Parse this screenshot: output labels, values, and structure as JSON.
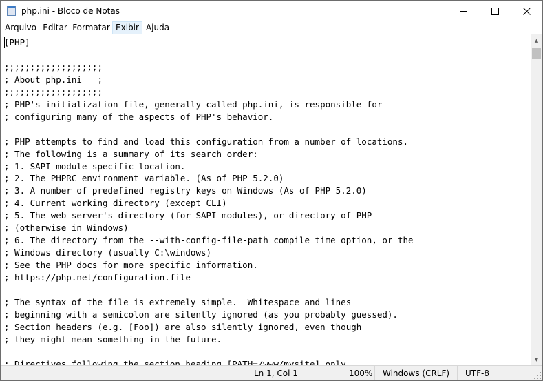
{
  "window": {
    "title": "php.ini - Bloco de Notas"
  },
  "menu": {
    "items": [
      "Arquivo",
      "Editar",
      "Formatar",
      "Exibir",
      "Ajuda"
    ],
    "active": "Exibir"
  },
  "editor": {
    "lines": [
      "[PHP]",
      "",
      ";;;;;;;;;;;;;;;;;;;",
      "; About php.ini   ;",
      ";;;;;;;;;;;;;;;;;;;",
      "; PHP's initialization file, generally called php.ini, is responsible for",
      "; configuring many of the aspects of PHP's behavior.",
      "",
      "; PHP attempts to find and load this configuration from a number of locations.",
      "; The following is a summary of its search order:",
      "; 1. SAPI module specific location.",
      "; 2. The PHPRC environment variable. (As of PHP 5.2.0)",
      "; 3. A number of predefined registry keys on Windows (As of PHP 5.2.0)",
      "; 4. Current working directory (except CLI)",
      "; 5. The web server's directory (for SAPI modules), or directory of PHP",
      "; (otherwise in Windows)",
      "; 6. The directory from the --with-config-file-path compile time option, or the",
      "; Windows directory (usually C:\\windows)",
      "; See the PHP docs for more specific information.",
      "; https://php.net/configuration.file",
      "",
      "; The syntax of the file is extremely simple.  Whitespace and lines",
      "; beginning with a semicolon are silently ignored (as you probably guessed).",
      "; Section headers (e.g. [Foo]) are also silently ignored, even though",
      "; they might mean something in the future.",
      "",
      "; Directives following the section heading [PATH=/www/mysite] only"
    ]
  },
  "status": {
    "position": "Ln 1, Col 1",
    "zoom": "100%",
    "line_ending": "Windows (CRLF)",
    "encoding": "UTF-8"
  }
}
